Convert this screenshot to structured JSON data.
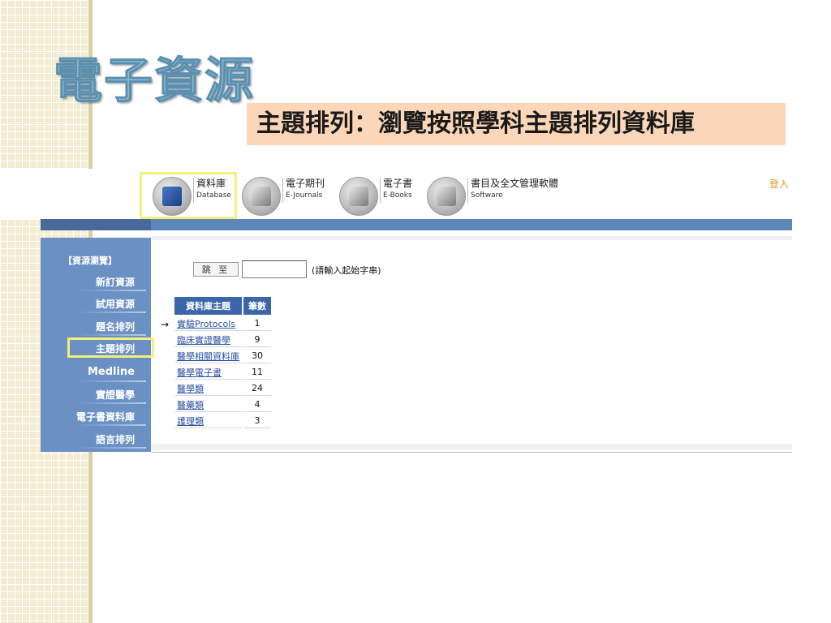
{
  "slide": {
    "title": "電子資源",
    "subtitle": "主題排列：瀏覽按照學科主題排列資料庫"
  },
  "nav": {
    "items": [
      {
        "zh": "資料庫",
        "en": "Database",
        "icon": "database-icon"
      },
      {
        "zh": "電子期刊",
        "en": "E-Journals",
        "icon": "ejournals-icon"
      },
      {
        "zh": "電子書",
        "en": "E-Books",
        "icon": "ebooks-icon"
      },
      {
        "zh": "書目及全文管理軟體",
        "en": "Software",
        "icon": "software-icon"
      }
    ],
    "login": "登入"
  },
  "sidebar": {
    "header": "【資源瀏覽】",
    "items": [
      {
        "label": "新訂資源"
      },
      {
        "label": "試用資源"
      },
      {
        "label": "題名排列"
      },
      {
        "label": "主題排列"
      },
      {
        "label": "Medline"
      },
      {
        "label": "實證醫學"
      },
      {
        "label": "電子書資料庫"
      },
      {
        "label": "語言排列"
      }
    ]
  },
  "search": {
    "jump_label": "跳 至",
    "hint": "(請輸入起始字串)",
    "value": ""
  },
  "table": {
    "headers": [
      "資料庫主題",
      "筆數"
    ],
    "rows": [
      {
        "name": "實驗Protocols",
        "count": "1"
      },
      {
        "name": "臨床實證醫學",
        "count": "9"
      },
      {
        "name": "醫學相關資料庫",
        "count": "30"
      },
      {
        "name": "醫學電子書",
        "count": "11"
      },
      {
        "name": "醫學類",
        "count": "24"
      },
      {
        "name": "醫藥類",
        "count": "4"
      },
      {
        "name": "護理類",
        "count": "3"
      }
    ],
    "arrow": "→"
  },
  "colors": {
    "menu_bg": "#6b90c4",
    "header_blue": "#3b66aa",
    "highlight": "#f4f07a",
    "subtitle_bg": "#fcd6b8"
  }
}
